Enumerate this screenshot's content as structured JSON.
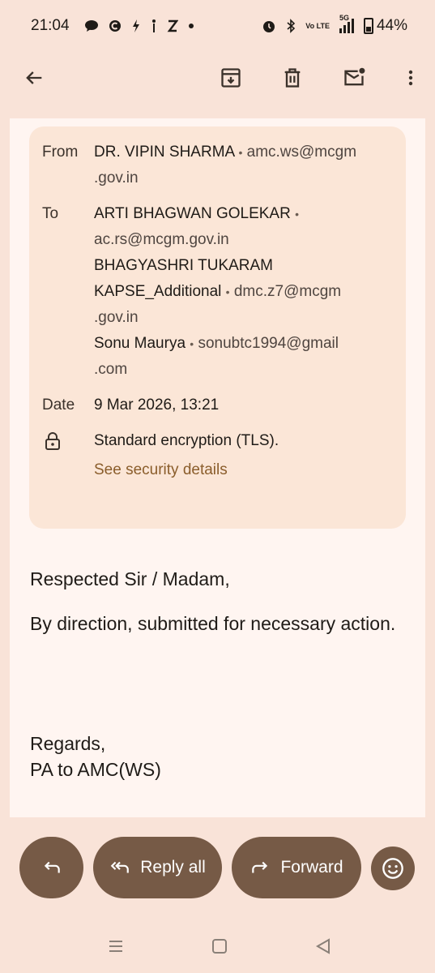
{
  "status_bar": {
    "time": "21:04",
    "left_icons": [
      "chat-bubble-icon",
      "c-icon",
      "bolt-icon",
      "antenna-icon",
      "z-icon",
      "dot-icon"
    ],
    "battery": "44%",
    "network": "5G",
    "volte": "Vo LTE"
  },
  "toolbar": {
    "back": "arrow-back-icon",
    "archive": "archive-icon",
    "delete": "trash-icon",
    "mark_unread": "mail-unread-icon",
    "more": "more-vert-icon"
  },
  "details": {
    "from_label": "From",
    "from_name": "DR. VIPIN SHARMA",
    "from_email_1": "amc.ws@mcgm",
    "from_email_2": ".gov.in",
    "to_label": "To",
    "to_1_name": "ARTI BHAGWAN GOLEKAR",
    "to_1_email": "ac.rs@mcgm.gov.in",
    "to_2_name_1": "BHAGYASHRI TUKARAM",
    "to_2_name_2": "KAPSE_Additional",
    "to_2_email_1": "dmc.z7@mcgm",
    "to_2_email_2": ".gov.in",
    "to_3_name": "Sonu Maurya",
    "to_3_email_1": "sonubtc1994@gmail",
    "to_3_email_2": ".com",
    "date_label": "Date",
    "date_value": "9 Mar 2026, 13:21",
    "encryption": "Standard encryption (TLS).",
    "security_link": "See security details",
    "separator": "•"
  },
  "body": {
    "greeting": "Respected Sir / Madam,",
    "message": "By direction, submitted for necessary action.",
    "regards": "Regards,",
    "signature": "PA to AMC(WS)"
  },
  "actions": {
    "reply_all": "Reply all",
    "forward": "Forward"
  },
  "colors": {
    "background": "#f9e3d8",
    "card": "#fbe6d7",
    "button": "#765a46",
    "link": "#8a5d2b"
  }
}
